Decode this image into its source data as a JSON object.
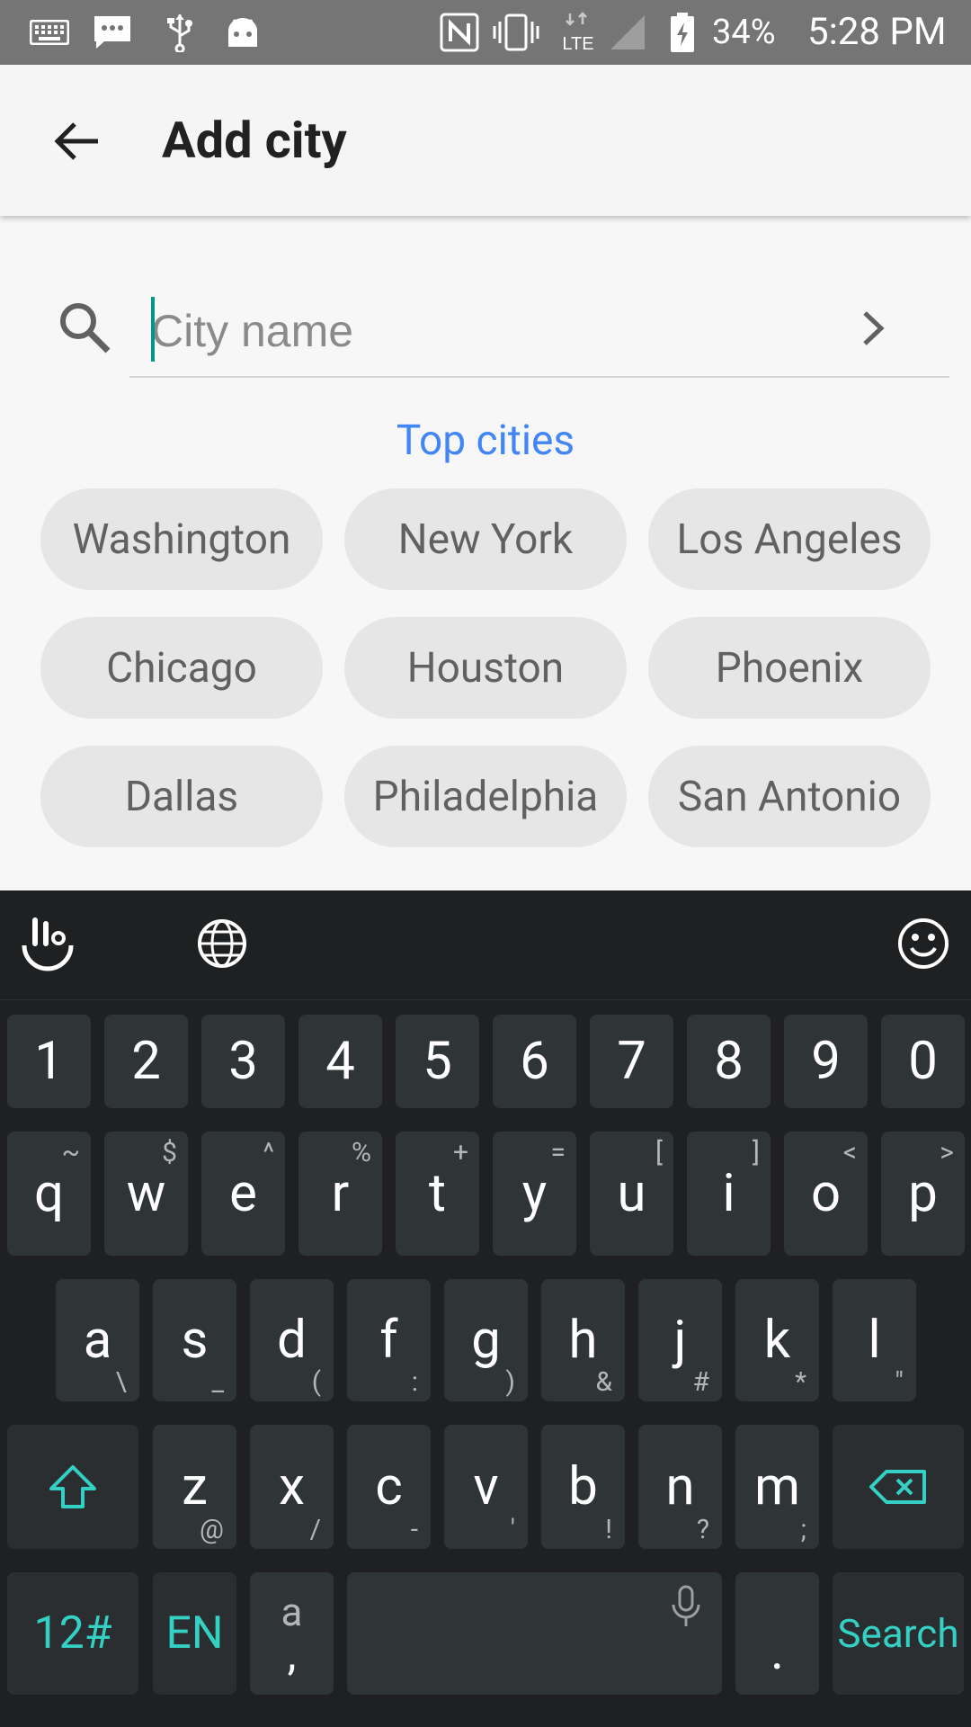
{
  "status_bar": {
    "battery": "34%",
    "network": "LTE",
    "time": "5:28 PM",
    "icons": [
      "keyboard-icon",
      "message-icon",
      "usb-icon",
      "android-icon",
      "nfc-icon",
      "vibrate-icon",
      "lte-icon",
      "signal-icon",
      "battery-icon"
    ]
  },
  "app_bar": {
    "title": "Add city",
    "back_icon": "arrow-back-icon"
  },
  "search": {
    "placeholder": "City name",
    "value": "",
    "icon": "search-icon",
    "go_icon": "chevron-right-icon"
  },
  "top_cities": {
    "label": "Top cities",
    "cities": [
      "Washington",
      "New York",
      "Los Angeles",
      "Chicago",
      "Houston",
      "Phoenix",
      "Dallas",
      "Philadelphia",
      "San Antonio"
    ]
  },
  "keyboard": {
    "toolbar_icons": [
      "swipe-gesture-icon",
      "globe-icon",
      "emoji-icon"
    ],
    "number_row": [
      "1",
      "2",
      "3",
      "4",
      "5",
      "6",
      "7",
      "8",
      "9",
      "0"
    ],
    "row1": [
      {
        "key": "q",
        "hint": "~"
      },
      {
        "key": "w",
        "hint": "$"
      },
      {
        "key": "e",
        "hint": "^"
      },
      {
        "key": "r",
        "hint": "%"
      },
      {
        "key": "t",
        "hint": "+"
      },
      {
        "key": "y",
        "hint": "="
      },
      {
        "key": "u",
        "hint": "["
      },
      {
        "key": "i",
        "hint": "]"
      },
      {
        "key": "o",
        "hint": "<"
      },
      {
        "key": "p",
        "hint": ">"
      }
    ],
    "row2": [
      {
        "key": "a",
        "hint": "\\"
      },
      {
        "key": "s",
        "hint": "_"
      },
      {
        "key": "d",
        "hint": "("
      },
      {
        "key": "f",
        "hint": ":"
      },
      {
        "key": "g",
        "hint": ")"
      },
      {
        "key": "h",
        "hint": "&"
      },
      {
        "key": "j",
        "hint": "#"
      },
      {
        "key": "k",
        "hint": "*"
      },
      {
        "key": "l",
        "hint": "\""
      }
    ],
    "row3": [
      {
        "key": "z",
        "hint": "@"
      },
      {
        "key": "x",
        "hint": "/"
      },
      {
        "key": "c",
        "hint": "-"
      },
      {
        "key": "v",
        "hint": "'"
      },
      {
        "key": "b",
        "hint": "!"
      },
      {
        "key": "n",
        "hint": "?"
      },
      {
        "key": "m",
        "hint": ";"
      }
    ],
    "shift_icon": "shift-icon",
    "backspace_icon": "backspace-icon",
    "symbols_label": "12#",
    "language_label": "EN",
    "punct_top": "a",
    "punct_bottom": ",",
    "mic_icon": "microphone-icon",
    "period_label": ".",
    "search_label": "Search",
    "accent_color": "#35d0c4"
  }
}
